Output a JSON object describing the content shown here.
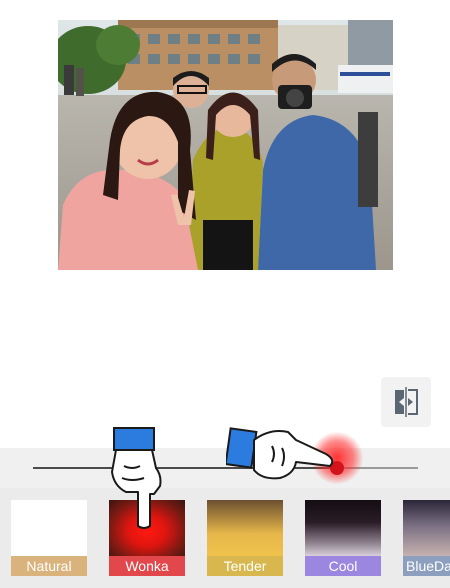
{
  "editor": {
    "compare_icon": "compare-split-icon",
    "intensity_slider": {
      "value": 0.79
    },
    "filters": [
      {
        "name": "Natural",
        "label_color": "#d9b27c",
        "swatch": "natural"
      },
      {
        "name": "Wonka",
        "label_color": "#e2474b",
        "swatch": "wonka"
      },
      {
        "name": "Tender",
        "label_color": "#d8b84e",
        "swatch": "tender"
      },
      {
        "name": "Cool",
        "label_color": "#9b87e0",
        "swatch": "cool"
      },
      {
        "name": "BlueDa",
        "label_color": "#8c9fbe",
        "swatch": "blueda"
      }
    ],
    "accent_color": "#d4141c",
    "gesture_hints": [
      "tap-hand-icon",
      "swipe-hand-icon"
    ]
  }
}
